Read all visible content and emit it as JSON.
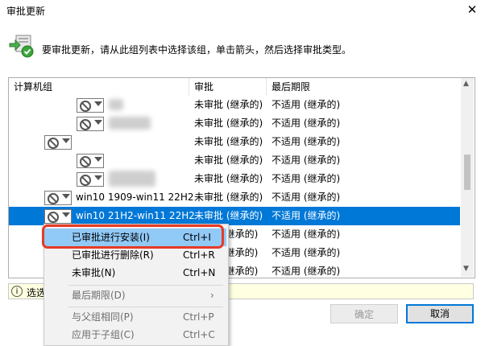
{
  "window": {
    "title": "审批更新",
    "close_glyph": "✕"
  },
  "instruction": "要审批更新，请从此组列表中选择该组，单击箭头，然后选择审批类型。",
  "table": {
    "headers": [
      "计算机组",
      "审批",
      "最后期限"
    ],
    "rows": [
      {
        "name": "",
        "approval": "未审批 (继承的)",
        "deadline": "不适用 (继承的)",
        "selected": false
      },
      {
        "name": "",
        "approval": "未审批 (继承的)",
        "deadline": "不适用 (继承的)",
        "selected": false
      },
      {
        "name": "",
        "approval": "未审批 (继承的)",
        "deadline": "不适用 (继承的)",
        "selected": false
      },
      {
        "name": "",
        "approval": "未审批 (继承的)",
        "deadline": "不适用 (继承的)",
        "selected": false
      },
      {
        "name": "",
        "approval": "未审批 (继承的)",
        "deadline": "不适用 (继承的)",
        "selected": false
      },
      {
        "name": "win10 1909-win11 22H2",
        "approval": "未审批 (继承的)",
        "deadline": "不适用 (继承的)",
        "selected": false
      },
      {
        "name": "win10 21H2-win11 22H2",
        "approval": "未审批 (继承的)",
        "deadline": "不适用 (继承的)",
        "selected": true
      },
      {
        "name": "",
        "approval": "(继承的)",
        "deadline": "不适用 (继承的)",
        "selected": false
      },
      {
        "name": "",
        "approval": "(继承的)",
        "deadline": "不适用 (继承的)",
        "selected": false
      },
      {
        "name": "",
        "approval": "(继承的)",
        "deadline": "不适用 (继承的)",
        "selected": false
      }
    ]
  },
  "context_menu": {
    "items": [
      {
        "label": "已审批进行安装(I)",
        "shortcut": "Ctrl+I"
      },
      {
        "label": "已审批进行删除(R)",
        "shortcut": "Ctrl+R"
      },
      {
        "label": "未审批(N)",
        "shortcut": "Ctrl+N"
      },
      {
        "label": "最后期限(D)",
        "shortcut": "›"
      },
      {
        "label": "与父组相同(P)",
        "shortcut": "Ctrl+P"
      },
      {
        "label": "应用于子组(C)",
        "shortcut": "Ctrl+C"
      }
    ]
  },
  "status": {
    "icon": "info-icon",
    "text": "选选"
  },
  "buttons": {
    "ok": "确定",
    "cancel": "取消"
  },
  "colors": {
    "selection": "#0078d7",
    "menu_highlight": "#91c9f7",
    "annotation_box": "#e83a25"
  }
}
